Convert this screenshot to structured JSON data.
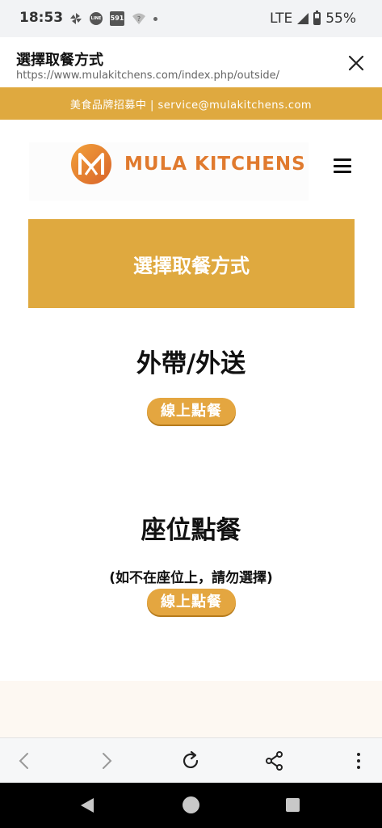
{
  "status_bar": {
    "time": "18:53",
    "line_icon_text": "LINE",
    "app_591_text": "591",
    "network": "LTE",
    "battery": "55%"
  },
  "browser": {
    "page_title": "選擇取餐方式",
    "url": "https://www.mulakitchens.com/index.php/outside/"
  },
  "promo": {
    "text": "美食品牌招募中 | service@mulakitchens.com"
  },
  "header": {
    "logo_text": "MULA KITCHENS"
  },
  "main": {
    "banner_title": "選擇取餐方式",
    "sections": [
      {
        "heading": "外帶/外送",
        "button_label": "線上點餐"
      },
      {
        "heading": "座位點餐",
        "note": "(如不在座位上，請勿選擇)",
        "button_label": "線上點餐"
      }
    ]
  },
  "colors": {
    "accent": "#dfa93f",
    "button": "#e4a640",
    "logo_orange": "#e07a2e"
  },
  "icons": {
    "close": "close-icon",
    "menu": "hamburger-menu-icon",
    "back": "back-arrow-icon",
    "forward": "forward-arrow-icon",
    "reload": "reload-icon",
    "share": "share-icon",
    "more": "more-vert-icon"
  }
}
